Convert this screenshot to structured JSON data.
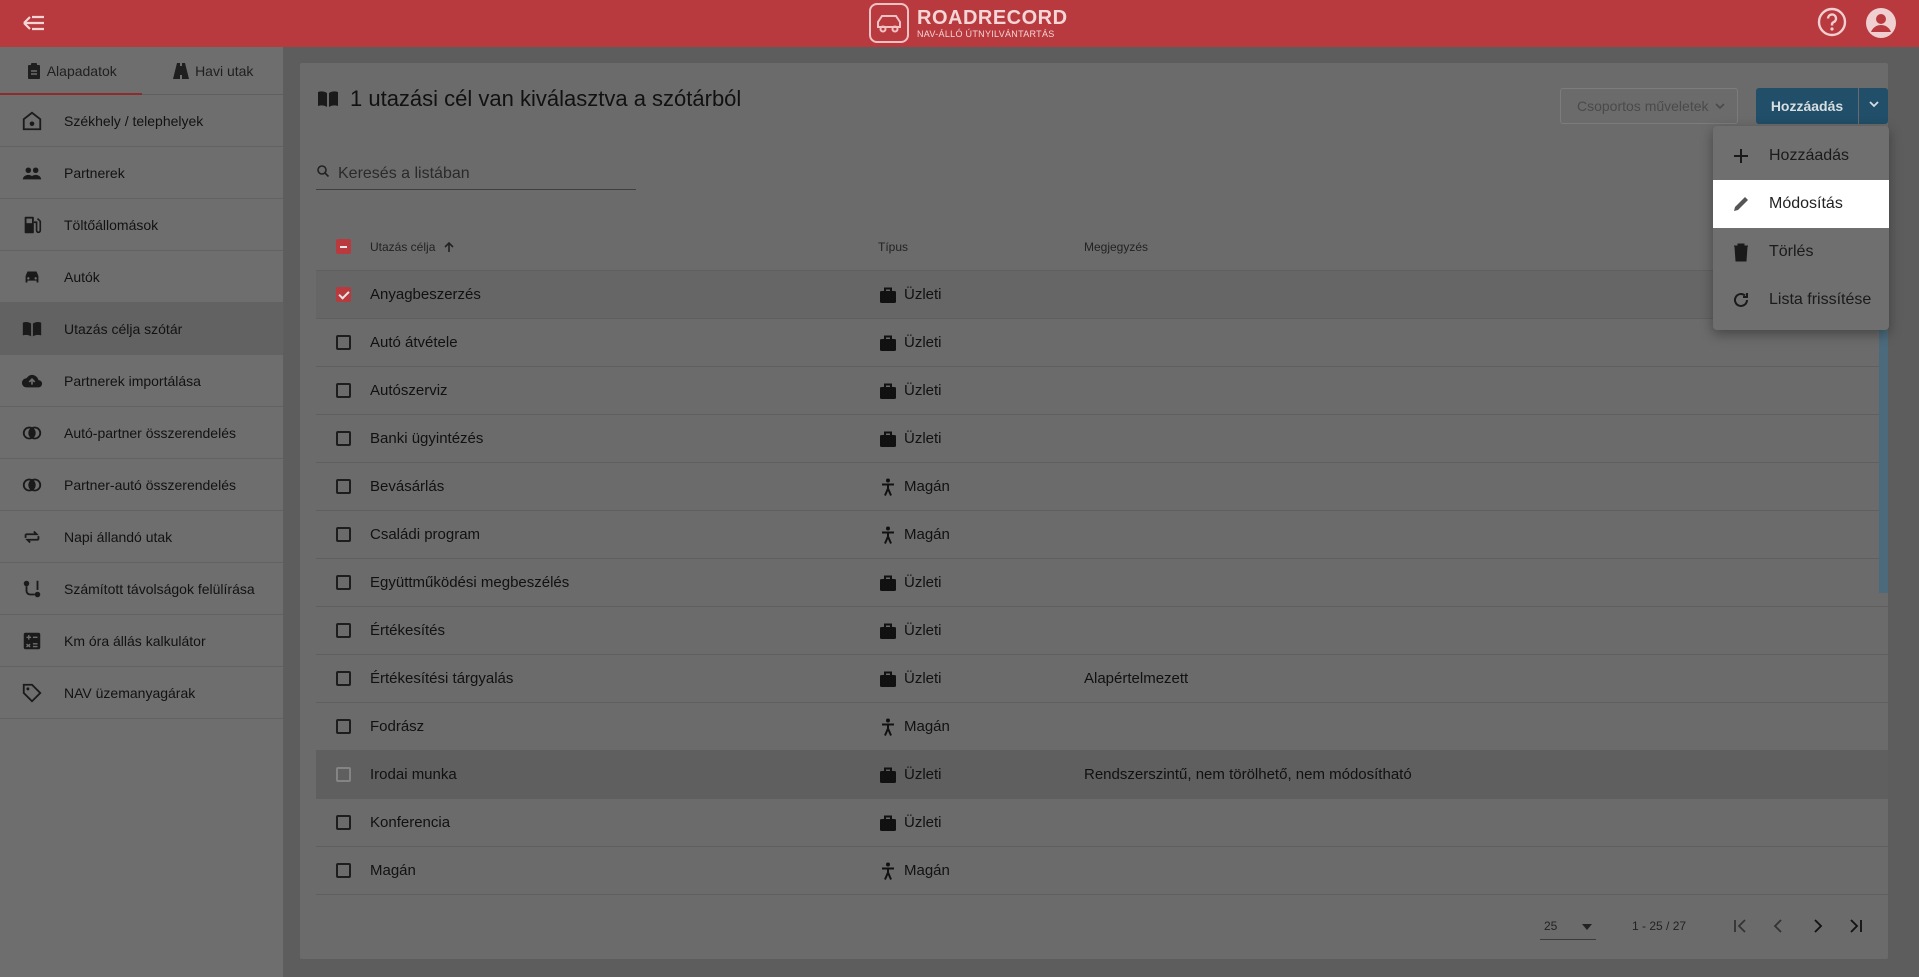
{
  "brand": {
    "name": "ROADRECORD",
    "tagline": "NAV-ÁLLÓ ÚTNYILVÁNTARTÁS"
  },
  "sidebar": {
    "tabs": [
      {
        "label": "Alapadatok",
        "icon": "clipboard-icon",
        "active": true
      },
      {
        "label": "Havi utak",
        "icon": "road-icon",
        "active": false
      }
    ],
    "items": [
      {
        "label": "Székhely / telephelyek",
        "icon": "home-gear-icon"
      },
      {
        "label": "Partnerek",
        "icon": "people-icon"
      },
      {
        "label": "Töltőállomások",
        "icon": "gas-station-icon"
      },
      {
        "label": "Autók",
        "icon": "car-icon"
      },
      {
        "label": "Utazás célja szótár",
        "icon": "book-icon",
        "active": true
      },
      {
        "label": "Partnerek importálása",
        "icon": "cloud-upload-icon"
      },
      {
        "label": "Autó-partner összerendelés",
        "icon": "link-circles-icon"
      },
      {
        "label": "Partner-autó összerendelés",
        "icon": "link-circles-icon"
      },
      {
        "label": "Napi állandó utak",
        "icon": "repeat-icon"
      },
      {
        "label": "Számított távolságok felülírása",
        "icon": "route-icon"
      },
      {
        "label": "Km óra állás kalkulátor",
        "icon": "calculator-icon"
      },
      {
        "label": "NAV üzemanyagárak",
        "icon": "tag-icon"
      }
    ]
  },
  "main": {
    "title": "1 utazási cél van kiválasztva a szótárból",
    "bulk_actions_label": "Csoportos műveletek",
    "add_label": "Hozzáadás",
    "search_placeholder": "Keresés a listában",
    "columns": {
      "name": "Utazás célja",
      "type": "Típus",
      "note": "Megjegyzés"
    },
    "rows": [
      {
        "name": "Anyagbeszerzés",
        "type": "Üzleti",
        "type_icon": "briefcase-icon",
        "note": "",
        "checked": true
      },
      {
        "name": "Autó átvétele",
        "type": "Üzleti",
        "type_icon": "briefcase-icon",
        "note": ""
      },
      {
        "name": "Autószerviz",
        "type": "Üzleti",
        "type_icon": "briefcase-icon",
        "note": ""
      },
      {
        "name": "Banki ügyintézés",
        "type": "Üzleti",
        "type_icon": "briefcase-icon",
        "note": ""
      },
      {
        "name": "Bevásárlás",
        "type": "Magán",
        "type_icon": "person-icon",
        "note": ""
      },
      {
        "name": "Családi program",
        "type": "Magán",
        "type_icon": "person-icon",
        "note": ""
      },
      {
        "name": "Együttműködési megbeszélés",
        "type": "Üzleti",
        "type_icon": "briefcase-icon",
        "note": ""
      },
      {
        "name": "Értékesítés",
        "type": "Üzleti",
        "type_icon": "briefcase-icon",
        "note": ""
      },
      {
        "name": "Értékesítési tárgyalás",
        "type": "Üzleti",
        "type_icon": "briefcase-icon",
        "note": "Alapértelmezett"
      },
      {
        "name": "Fodrász",
        "type": "Magán",
        "type_icon": "person-icon",
        "note": ""
      },
      {
        "name": "Irodai munka",
        "type": "Üzleti",
        "type_icon": "briefcase-icon",
        "note": "Rendszerszintű, nem törölhető, nem módosítható",
        "disabled": true
      },
      {
        "name": "Konferencia",
        "type": "Üzleti",
        "type_icon": "briefcase-icon",
        "note": ""
      },
      {
        "name": "Magán",
        "type": "Magán",
        "type_icon": "person-icon",
        "note": ""
      }
    ],
    "paginator": {
      "page_size": "25",
      "range": "1 - 25 / 27"
    }
  },
  "dropdown_menu": {
    "items": [
      {
        "label": "Hozzáadás",
        "icon": "plus-icon"
      },
      {
        "label": "Módosítás",
        "icon": "pencil-icon",
        "highlighted": true
      },
      {
        "label": "Törlés",
        "icon": "trash-icon"
      },
      {
        "label": "Lista frissítése",
        "icon": "refresh-icon"
      }
    ]
  },
  "colors": {
    "brand_red": "#b93a3e",
    "primary_button": "#214e68",
    "highlight": "#ffffff"
  }
}
